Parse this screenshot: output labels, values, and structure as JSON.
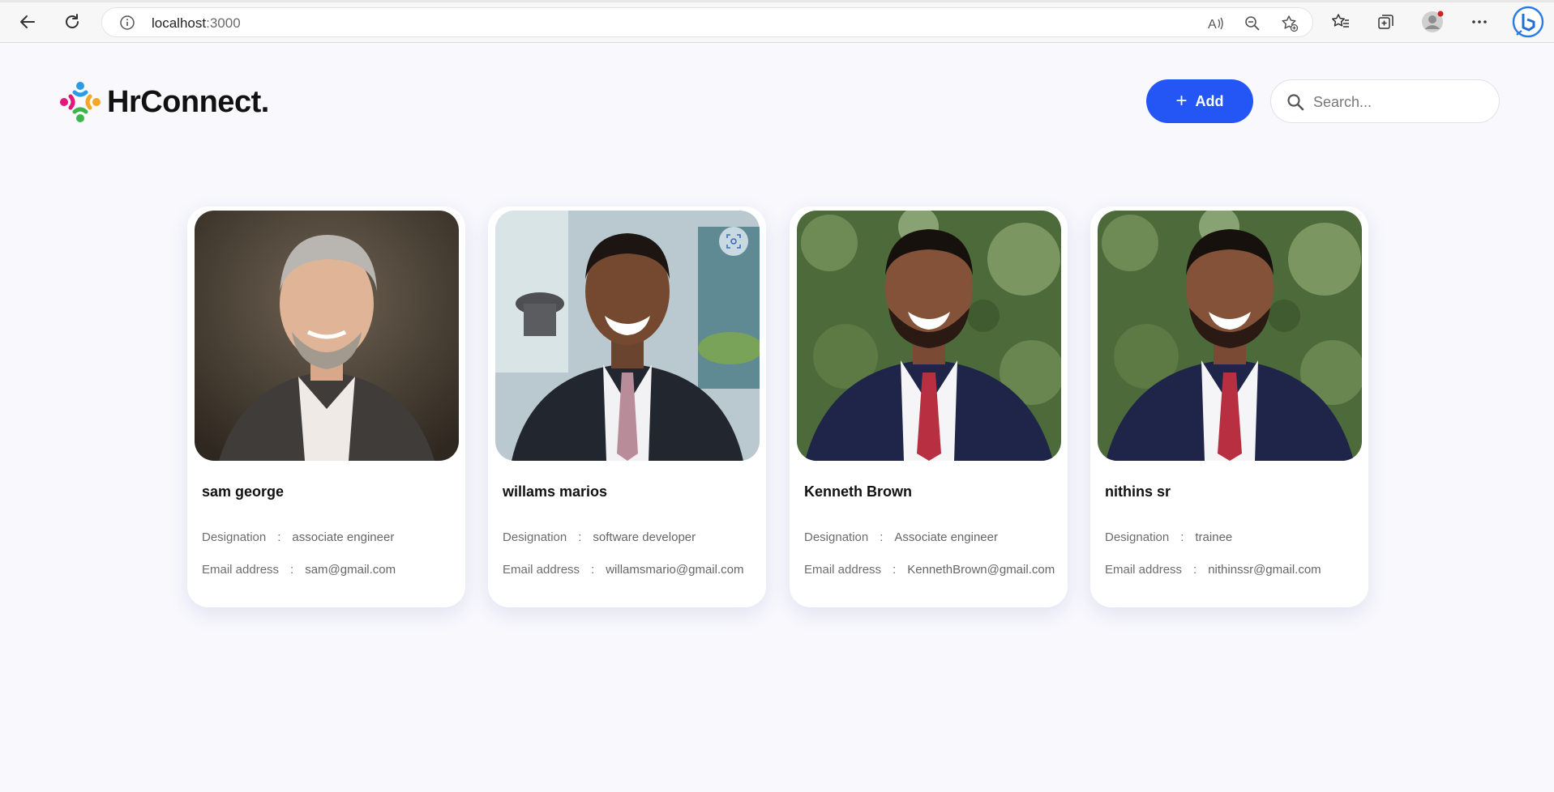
{
  "browser": {
    "url_host": "localhost",
    "url_port": ":3000"
  },
  "app": {
    "brand": "HrConnect.",
    "add_label": "Add",
    "search_placeholder": "Search..."
  },
  "employees": [
    {
      "name": "sam george",
      "designation_label": "Designation",
      "designation": "associate engineer",
      "email_label": "Email address",
      "email": "sam@gmail.com",
      "sep": ":"
    },
    {
      "name": "willams marios",
      "designation_label": "Designation",
      "designation": "software developer",
      "email_label": "Email address",
      "email": "willamsmario@gmail.com",
      "sep": ":"
    },
    {
      "name": "Kenneth Brown",
      "designation_label": "Designation",
      "designation": "Associate engineer",
      "email_label": "Email address",
      "email": "KennethBrown@gmail.com",
      "sep": ":"
    },
    {
      "name": "nithins sr",
      "designation_label": "Designation",
      "designation": "trainee",
      "email_label": "Email address",
      "email": "nithinssr@gmail.com",
      "sep": ":"
    }
  ],
  "colors": {
    "accent": "#2456f6",
    "background": "#f8f8fd"
  }
}
